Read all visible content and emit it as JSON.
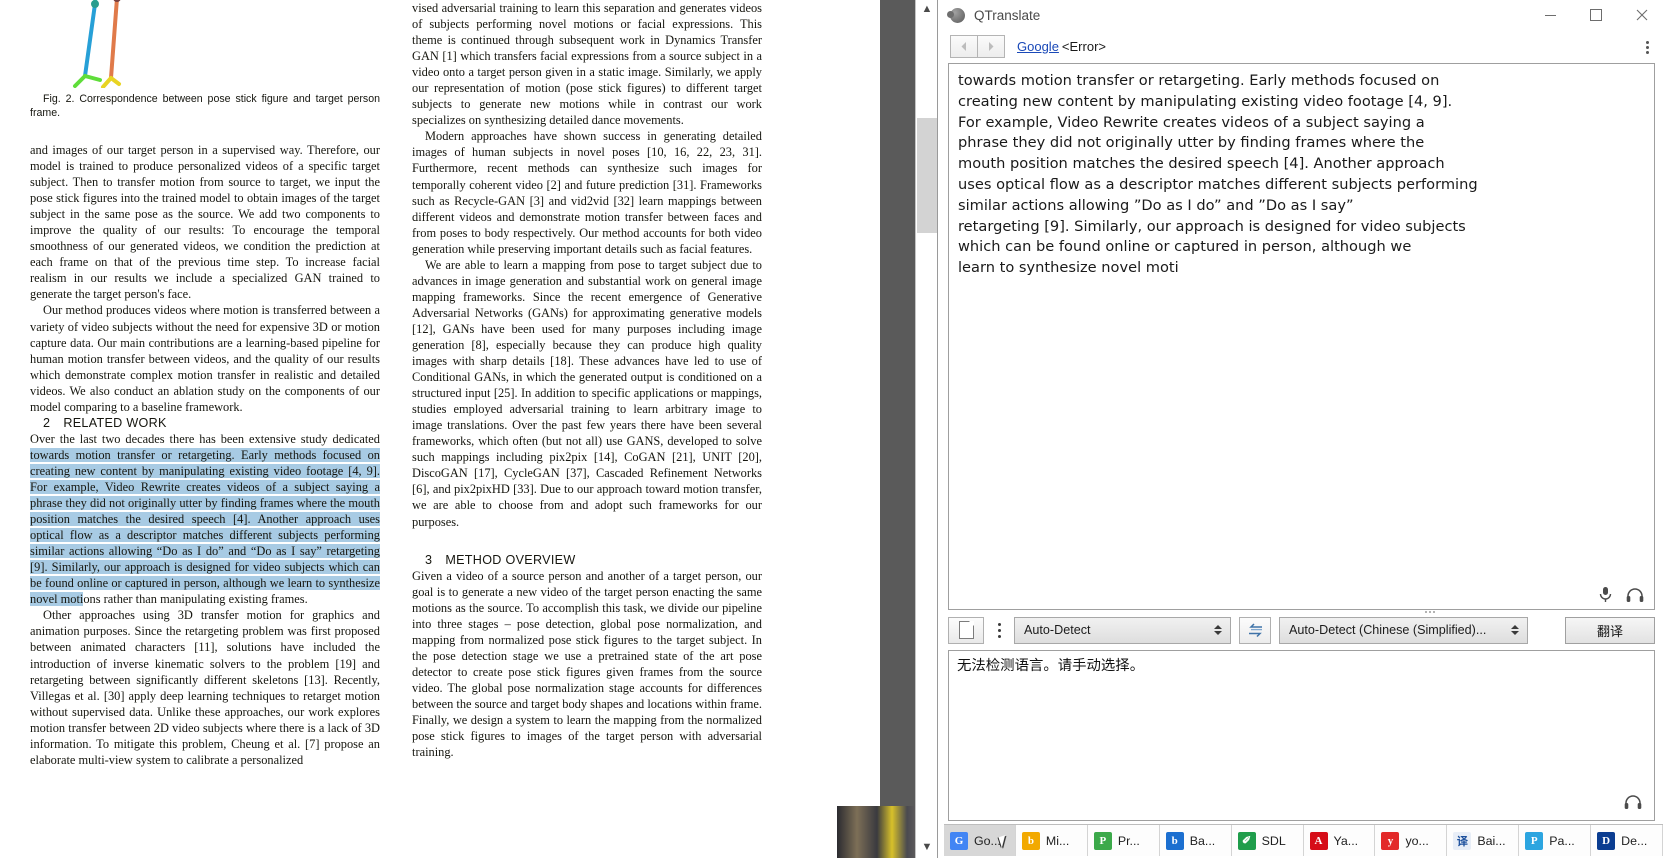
{
  "pdf": {
    "figure_caption": "Fig. 2.  Correspondence between pose stick figure and target person frame.",
    "left_column": {
      "para1": "and images of our target person in a supervised way. Therefore, our model is trained to produce personalized videos of a specific target subject. Then to transfer motion from source to target, we input the pose stick figures into the trained model to obtain images of the target subject in the same pose as the source. We add two components to improve the quality of our results: To encourage the temporal smoothness of our generated videos, we condition the prediction at each frame on that of the previous time step. To increase facial realism in our results we include a specialized GAN trained to generate the target person's face.",
      "para2": "Our method produces videos where motion is transferred between a variety of video subjects without the need for expensive 3D or motion capture data. Our main contributions are a learning-based pipeline for human motion transfer between videos, and the quality of our results which demonstrate complex motion transfer in realistic and detailed videos. We also conduct an ablation study on the components of our model comparing to a baseline framework.",
      "section_number": "2",
      "section_title": "RELATED WORK",
      "para3_pre": "Over the last two decades there has been extensive study dedicated ",
      "para3_highlighted": "towards motion transfer or retargeting. Early methods focused on creating new content by manipulating existing video footage [4, 9]. For example, Video Rewrite creates videos of a subject saying a phrase they did not originally utter by finding frames where the mouth position matches the desired speech [4]. Another approach uses optical flow as a descriptor matches different subjects performing similar actions allowing “Do as I do” and “Do as I say” retargeting [9]. Similarly, our approach is designed for video subjects which can be found online or captured in person, although we learn to synthesize novel moti",
      "para3_post": "ons rather than manipulating existing frames.",
      "para4": "Other approaches using 3D transfer motion for graphics and animation purposes. Since the retargeting problem was first proposed between animated characters [11], solutions have included the introduction of inverse kinematic solvers to the problem [19] and retargeting between significantly different skeletons [13]. Recently, Villegas et al. [30] apply deep learning techniques to retarget motion without supervised data. Unlike these approaches, our work explores motion transfer between 2D video subjects where there is a lack of 3D information. To mitigate this problem, Cheung et al. [7] propose an elaborate multi-view system to calibrate a personalized"
    },
    "right_column": {
      "para1": "vised adversarial training to learn this separation and generates videos of subjects performing novel motions or facial expressions. This theme is continued through subsequent work in Dynamics Transfer GAN [1] which transfers facial expressions from a source subject in a video onto a target person given in a static image. Similarly, we apply our representation of motion (pose stick figures) to different target subjects to generate new motions while in contrast our work specializes on synthesizing detailed dance movements.",
      "para2": "Modern approaches have shown success in generating detailed images of human subjects in novel poses [10, 16, 22, 23, 31]. Furthermore, recent methods can synthesize such images for temporally coherent video [2] and future prediction [31]. Frameworks such as Recycle-GAN [3] and vid2vid [32] learn mappings between different videos and demonstrate motion transfer between faces and from poses to body respectively. Our method accounts for both video generation while preserving important details such as facial features.",
      "para3": "We are able to learn a mapping from pose to target subject due to advances in image generation and substantial work on general image mapping frameworks. Since the recent emergence of Generative Adversarial Networks (GANs) for approximating generative models [12], GANs have been used for many purposes including image generation [8], especially because they can produce high quality images with sharp details [18]. These advances have led to use of Conditional GANs, in which the generated output is conditioned on a structured input [25]. In addition to specific applications or mappings, studies employed adversarial training to learn arbitrary image to image translations. Over the past few years there have been several frameworks, which often (but not all) use GANS, developed to solve such mappings including pix2pix [14], CoGAN [21], UNIT [20], DiscoGAN [17], CycleGAN [37], Cascaded Refinement Networks [6], and pix2pixHD [33]. Due to our approach toward motion transfer, we are able to choose from and adopt such frameworks for our purposes.",
      "section_number": "3",
      "section_title": "METHOD OVERVIEW",
      "para4": "Given a video of a source person and another of a target person, our goal is to generate a new video of the target person enacting the same motions as the source. To accomplish this task, we divide our pipeline into three stages – pose detection, global pose normalization, and mapping from normalized pose stick figures to the target subject. In the pose detection stage we use a pretrained state of the art pose detector to create pose stick figures given frames from the source video. The global pose normalization stage accounts for differences between the source and target body shapes and locations within frame. Finally, we design a system to learn the mapping from the normalized pose stick figures to images of the target person with adversarial training."
    }
  },
  "qtranslate": {
    "title": "QTranslate",
    "nav": {
      "back_glyph": "◀",
      "forward_glyph": "▶",
      "service_link": "Google",
      "status": "<Error>"
    },
    "window_buttons": {
      "minimize": "—",
      "maximize": "□",
      "close": "✕"
    },
    "result_text": "towards motion transfer or retargeting. Early methods focused on\ncreating new content by manipulating existing video footage [4, 9].\nFor example, Video Rewrite creates videos of a subject saying a\nphrase they did not originally utter by finding frames where the\nmouth position matches the desired speech [4]. Another approach\nuses optical flow as a descriptor matches different subjects performing\nsimilar actions allowing ”Do as I do” and ”Do as I say”\nretargeting [9]. Similarly, our approach is designed for video subjects\nwhich can be found online or captured in person, although we\nlearn to synthesize novel moti",
    "source_text": "无法检测语言。请手动选择。",
    "controls": {
      "dictionary_icon": "page-icon",
      "menu_icon": "three-dots-icon",
      "source_language": "Auto-Detect",
      "swap_icon": "swap-arrows-icon",
      "target_language": "Auto-Detect (Chinese (Simplified)...",
      "translate_button": "翻译"
    },
    "result_icons": {
      "microphone": "microphone-icon",
      "headphones": "headphones-icon"
    },
    "services": [
      {
        "label": "Go...",
        "icon_text": "G",
        "color": "#4285f4",
        "active": true
      },
      {
        "label": "Mi...",
        "icon_text": "b",
        "color": "#f2a900",
        "active": false
      },
      {
        "label": "Pr...",
        "icon_text": "P",
        "color": "#3ca94a",
        "active": false
      },
      {
        "label": "Ba...",
        "icon_text": "b",
        "color": "#1c6fd0",
        "active": false
      },
      {
        "label": "SDL",
        "icon_text": "✐",
        "color": "#1f9d4b",
        "active": false
      },
      {
        "label": "Ya...",
        "icon_text": "A",
        "color": "#d60d18",
        "active": false
      },
      {
        "label": "yo...",
        "icon_text": "y",
        "color": "#e32a2a",
        "active": false
      },
      {
        "label": "Bai...",
        "icon_text": "译",
        "color": "#e8eef7",
        "active": false
      },
      {
        "label": "Pa...",
        "icon_text": "P",
        "color": "#2ca5e0",
        "active": false
      },
      {
        "label": "De...",
        "icon_text": "D",
        "color": "#0b3d91",
        "active": false
      }
    ]
  }
}
